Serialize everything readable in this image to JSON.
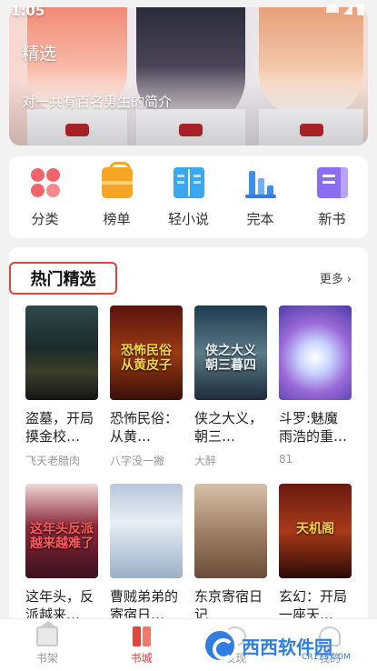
{
  "status_bar": {
    "time": "1:05"
  },
  "banner": {
    "title": "精选",
    "description": "对一共有百名男生的简介"
  },
  "categories": [
    {
      "label": "分类",
      "icon": "category-grid-icon"
    },
    {
      "label": "榜单",
      "icon": "ranking-bag-icon"
    },
    {
      "label": "轻小说",
      "icon": "light-novel-book-icon"
    },
    {
      "label": "完本",
      "icon": "completed-bars-icon"
    },
    {
      "label": "新书",
      "icon": "new-book-icon"
    }
  ],
  "hot": {
    "title": "热门精选",
    "more": "更多",
    "books": [
      {
        "title": "盗墓，开局摸金校…",
        "author": "飞天老腊肉",
        "cover_text": ""
      },
      {
        "title": "恐怖民俗：从黄…",
        "author": "八字没一撇",
        "cover_text": "恐怖民俗 从黄皮子"
      },
      {
        "title": "侠之大义，朝三…",
        "author": "大醉",
        "cover_text": "侠之大义 朝三暮四"
      },
      {
        "title": "斗罗:魅魔雨浩的重…",
        "author": "81",
        "cover_text": ""
      },
      {
        "title": "这年头，反派越来…",
        "author": "",
        "cover_text": "这年头反派 越来越难了"
      },
      {
        "title": "曹贼弟弟的寄宿日…",
        "author": "",
        "cover_text": ""
      },
      {
        "title": "东京寄宿日记",
        "author": "",
        "cover_text": ""
      },
      {
        "title": "玄幻：开局一座天…",
        "author": "",
        "cover_text": "天机阁"
      }
    ]
  },
  "bottom_nav": [
    {
      "label": "书架",
      "icon": "bookshelf-icon"
    },
    {
      "label": "书城",
      "icon": "bookstore-icon"
    },
    {
      "label": "发现",
      "icon": "discover-icon"
    },
    {
      "label": "我的",
      "icon": "profile-icon"
    }
  ],
  "watermark": {
    "text": "西西软件园",
    "sub": "CR173.COM"
  },
  "colors": {
    "accent": "#e0443b",
    "background": "#f2f2f2"
  }
}
